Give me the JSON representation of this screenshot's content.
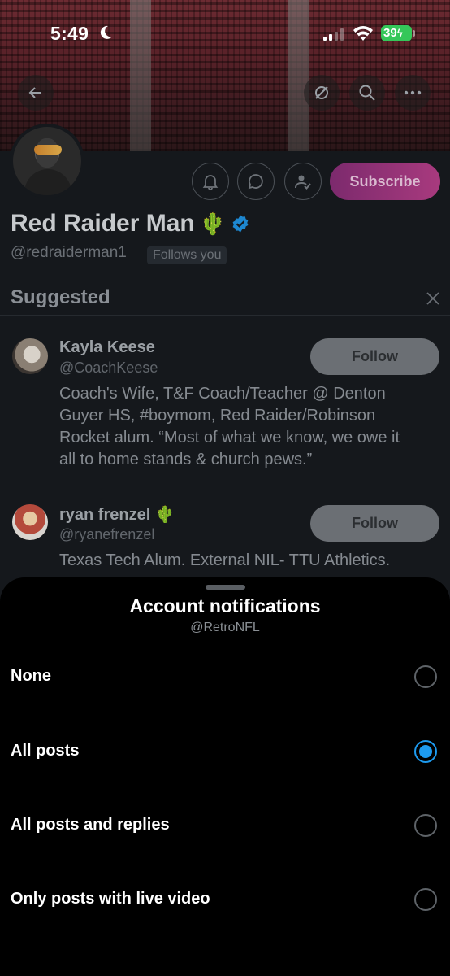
{
  "status_bar": {
    "time": "5:49",
    "battery": "39"
  },
  "profile": {
    "name": "Red Raider Man",
    "name_emoji": "🌵",
    "handle": "@redraiderman1",
    "follows_you": "Follows you",
    "subscribe_label": "Subscribe"
  },
  "suggested": {
    "title": "Suggested",
    "accounts": [
      {
        "name": "Kayla Keese",
        "emoji": "",
        "handle": "@CoachKeese",
        "bio": "Coach's Wife, T&F Coach/Teacher @ Denton Guyer HS, #boymom, Red Raider/Robinson Rocket alum. “Most of what we know, we owe it all to home stands & church pews.”",
        "follow_label": "Follow"
      },
      {
        "name": "ryan frenzel",
        "emoji": "🌵",
        "handle": "@ryanefrenzel",
        "bio": "Texas Tech Alum. External NIL- TTU Athletics.",
        "follow_label": "Follow"
      }
    ]
  },
  "sheet": {
    "title": "Account notifications",
    "subtitle": "@RetroNFL",
    "options": [
      {
        "label": "None",
        "selected": false
      },
      {
        "label": "All posts",
        "selected": true
      },
      {
        "label": "All posts and replies",
        "selected": false
      },
      {
        "label": "Only posts with live video",
        "selected": false
      }
    ]
  },
  "colors": {
    "accent": "#1d9bf0",
    "verified": "#1d9bf0",
    "battery": "#34c759",
    "subscribe": "#a83a7e"
  }
}
